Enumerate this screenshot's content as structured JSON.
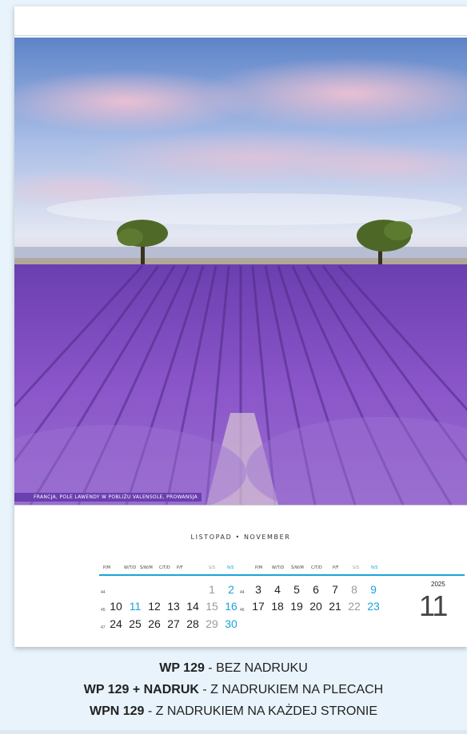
{
  "photo": {
    "caption": "FRANCJA, POLE LAWENDY W POBLIŻU VALENSOLE, PROWANSJA"
  },
  "calendar": {
    "month_title": "LISTOPAD • NOVEMBER",
    "year": "2025",
    "month_number": "11",
    "day_headers": [
      [
        "P/M",
        "W/T/D",
        "Ś/W/M",
        "C/T/D",
        "P/F",
        "S/S",
        "N/S"
      ],
      [
        "P/M",
        "W/T/D",
        "Ś/W/M",
        "C/T/D",
        "P/F",
        "S/S",
        "N/S"
      ]
    ],
    "week_numbers": [
      "44",
      "45",
      "46",
      "47",
      "48"
    ],
    "rows": [
      [
        "",
        "",
        "",
        "",
        "",
        "1",
        "2",
        "3",
        "4",
        "5",
        "6",
        "7",
        "8",
        "9"
      ],
      [
        "10",
        "11",
        "12",
        "13",
        "14",
        "15",
        "16",
        "17",
        "18",
        "19",
        "20",
        "21",
        "22",
        "23"
      ],
      [
        "24",
        "25",
        "26",
        "27",
        "28",
        "29",
        "30",
        "",
        "",
        "",
        "",
        "",
        "",
        ""
      ]
    ]
  },
  "products": [
    {
      "code": "WP 129",
      "desc": " - BEZ NADRUKU"
    },
    {
      "code": "WP 129 + NADRUK",
      "desc": " - Z NADRUKIEM NA PLECACH"
    },
    {
      "code": "WPN 129",
      "desc": " -  Z NADRUKIEM NA KAŻDEJ STRONIE"
    }
  ],
  "colors": {
    "accent": "#1aa3d9",
    "lavender": "#7c4fc4",
    "sky": "#8fb2e0"
  }
}
